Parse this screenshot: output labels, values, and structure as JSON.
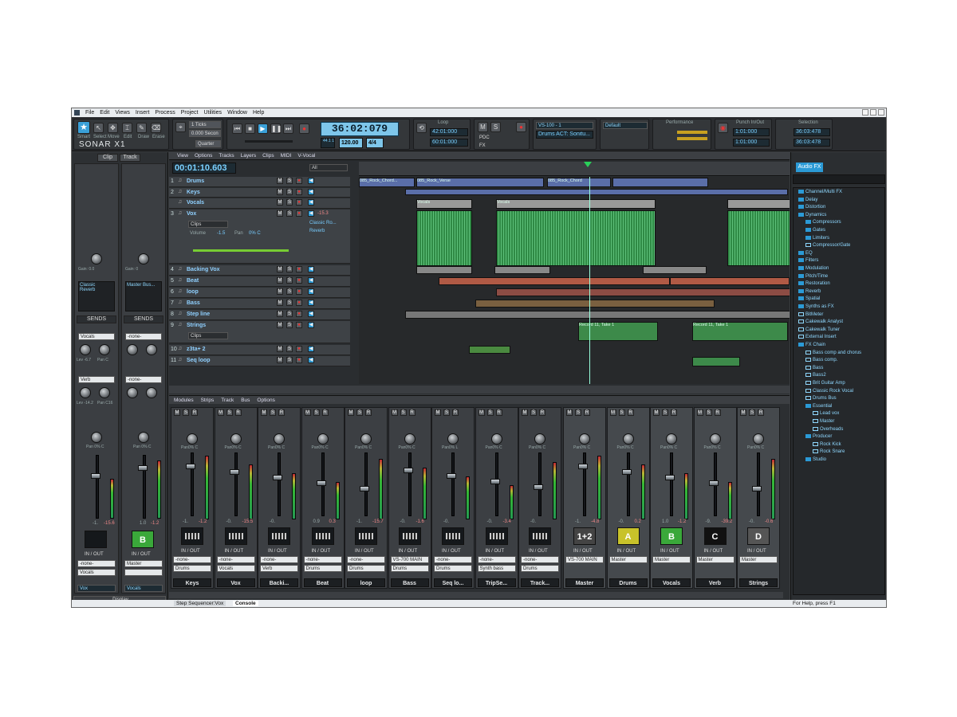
{
  "app": {
    "title": "SONAR X1"
  },
  "menu": [
    "File",
    "Edit",
    "Views",
    "Insert",
    "Process",
    "Project",
    "Utilities",
    "Window",
    "Help"
  ],
  "controlbar": {
    "tools": [
      "Smart",
      "Select",
      "Move",
      "Edit",
      "Draw",
      "Erase"
    ],
    "snap": {
      "value": "1 Ticks",
      "sub": "0.000 Secon",
      "quant": "Quarter"
    },
    "clock": "36:02:079",
    "tempo": "120.00",
    "meter": "4/4",
    "sig": "44.1 16",
    "loop": {
      "label": "Loop",
      "start": "42:01:000",
      "end": "60:01:000"
    },
    "vs": {
      "label": "VS-100 - 1",
      "preset": "Drums ACT: Sonitu..."
    },
    "default_label": "Default",
    "perf_label": "Performance",
    "punch": {
      "label": "Punch In/Out",
      "start": "1:01:000",
      "end": "1:01:000"
    },
    "selection": {
      "label": "Selection",
      "start": "36:03:478",
      "end": "36:03:478"
    },
    "pdc": "PDC",
    "fx": "FX"
  },
  "inspector": {
    "tabs": [
      "Clip",
      "Track"
    ],
    "strips": [
      {
        "gain": "Gain: 0.0",
        "pan": "Pan 0% C",
        "fx": [
          "Classic",
          "Reverb"
        ],
        "sends": "SENDS",
        "send1": "Vocals",
        "send2": "Verb",
        "lev1": "Lev -6.7",
        "pan1": "Pan C",
        "lev2": "Lev -14.2",
        "pan2": "Pan C16",
        "vol": "-1.",
        "peak": "-15.6",
        "letter": "",
        "io": "IN / OUT",
        "in": "-none-",
        "out": "Vocals",
        "name": "Vox"
      },
      {
        "gain": "Gain: 0",
        "pan": "Pan 0% C",
        "fx": [
          "Master Bus..."
        ],
        "sends": "SENDS",
        "send1": "-none-",
        "send2": "-none-",
        "lev1": "",
        "pan1": "",
        "lev2": "",
        "pan2": "",
        "vol": "1.0",
        "peak": "-1.2",
        "letter": "B",
        "io": "IN / OUT",
        "in": "Master",
        "out": "",
        "name": "Vocals"
      }
    ],
    "display": "Display"
  },
  "trackview": {
    "menu": [
      "View",
      "Options",
      "Tracks",
      "Layers",
      "Clips",
      "MIDI",
      "V-Vocal"
    ],
    "now": "00:01:10.603",
    "filter": "All",
    "tracks": [
      {
        "n": "1",
        "name": "Drums"
      },
      {
        "n": "2",
        "name": "Keys"
      },
      {
        "n": "",
        "name": "Vocals"
      },
      {
        "n": "3",
        "name": "Vox"
      },
      {
        "n": "4",
        "name": "Backing Vox"
      },
      {
        "n": "5",
        "name": "Beat"
      },
      {
        "n": "6",
        "name": "loop"
      },
      {
        "n": "7",
        "name": "Bass"
      },
      {
        "n": "8",
        "name": "Step line"
      },
      {
        "n": "9",
        "name": "Strings"
      },
      {
        "n": "10",
        "name": "z3ta+ 2"
      },
      {
        "n": "11",
        "name": "Seq loop"
      }
    ],
    "vox": {
      "clips": "Clips",
      "volume": "Volume",
      "vol_val": "-1.5",
      "pan": "Pan",
      "pan_val": "0% C",
      "fx1": "Classic Ro...",
      "fx2": "Reverb",
      "level": "-15.3"
    },
    "strings_clips": "Clips",
    "clip_labels": [
      "085_Rock_Chord...",
      "085_Rock_Verse",
      "085_Rock_Chord",
      "Vocals",
      "Vocals",
      "Record 11, Take 1",
      "Record 11, Take 1"
    ]
  },
  "console": {
    "menu": [
      "Modules",
      "Strips",
      "Track",
      "Bus",
      "Options"
    ],
    "strips": [
      {
        "pan": "Pan0% C",
        "vol": "-1.",
        "pk": "-1.2",
        "name": "Keys",
        "in": "-none-",
        "out": "Drums",
        "icon": "keyboard"
      },
      {
        "pan": "Pan0% C",
        "vol": "-0.",
        "pk": "-15.5",
        "name": "Vox",
        "in": "-none-",
        "out": "Vocals",
        "icon": "mic"
      },
      {
        "pan": "Pan0% C",
        "vol": "-0.",
        "pk": "",
        "name": "Backi...",
        "in": "-none-",
        "out": "Verb",
        "icon": "guitar"
      },
      {
        "pan": "Pan0% C",
        "vol": "0.9",
        "pk": "0.3",
        "name": "Beat",
        "in": "-none-",
        "out": "Drums",
        "icon": "rack"
      },
      {
        "pan": "Pan0% C",
        "vol": "-1.",
        "pk": "-15.7",
        "name": "loop",
        "in": "-none-",
        "out": "Drums",
        "icon": "wave"
      },
      {
        "pan": "Pan0% C",
        "vol": "-0.",
        "pk": "-1.6",
        "name": "Bass",
        "in": "VS-700 MAIN",
        "out": "Drums",
        "icon": "wave"
      },
      {
        "pan": "Pan0% L",
        "vol": "-0.",
        "pk": "",
        "name": "Seq lo...",
        "in": "-none-",
        "out": "Drums",
        "icon": "drums"
      },
      {
        "pan": "Pan0% C",
        "vol": "-0.",
        "pk": "-3.4",
        "name": "TripSe...",
        "in": "-none-",
        "out": "Synth bass",
        "icon": "keys"
      },
      {
        "pan": "Pan0% C",
        "vol": "-0.",
        "pk": "",
        "name": "Track...",
        "in": "-none-",
        "out": "Drums",
        "icon": "wave"
      }
    ],
    "buses": [
      {
        "pan": "Pan0% C",
        "vol": "-1.",
        "pk": "-4.8",
        "name": "Master",
        "letter": "1+2",
        "color": "#444",
        "out": "VS-700 MAIN"
      },
      {
        "pan": "Pan0% C",
        "vol": "-0.",
        "pk": "0.2",
        "name": "Drums",
        "letter": "A",
        "color": "#c8c22a",
        "out": "Master"
      },
      {
        "pan": "Pan0% C",
        "vol": "1.0",
        "pk": "-1.2",
        "name": "Vocals",
        "letter": "B",
        "color": "#3aa83a",
        "out": "Master"
      },
      {
        "pan": "Pan0% C",
        "vol": "-9.",
        "pk": "-39.2",
        "name": "Verb",
        "letter": "C",
        "color": "#111",
        "out": "Master"
      },
      {
        "pan": "Pan0% C",
        "vol": "-0.",
        "pk": "-0.6",
        "name": "Strings",
        "letter": "D",
        "color": "#555",
        "out": "Master"
      }
    ],
    "io": "IN / OUT"
  },
  "browser": {
    "tab": "Audio FX",
    "items": [
      {
        "t": "Channel/Multi FX",
        "lvl": 0,
        "f": 1
      },
      {
        "t": "Delay",
        "lvl": 0,
        "f": 1
      },
      {
        "t": "Distortion",
        "lvl": 0,
        "f": 1
      },
      {
        "t": "Dynamics",
        "lvl": 0,
        "f": 1
      },
      {
        "t": "Compressors",
        "lvl": 1,
        "f": 1
      },
      {
        "t": "Gates",
        "lvl": 1,
        "f": 1
      },
      {
        "t": "Limiters",
        "lvl": 1,
        "f": 1
      },
      {
        "t": "Compressor/Gate",
        "lvl": 1,
        "f": 0
      },
      {
        "t": "EQ",
        "lvl": 0,
        "f": 1
      },
      {
        "t": "Filters",
        "lvl": 0,
        "f": 1
      },
      {
        "t": "Modulation",
        "lvl": 0,
        "f": 1
      },
      {
        "t": "Pitch/Time",
        "lvl": 0,
        "f": 1
      },
      {
        "t": "Restoration",
        "lvl": 0,
        "f": 1
      },
      {
        "t": "Reverb",
        "lvl": 0,
        "f": 1
      },
      {
        "t": "Spatial",
        "lvl": 0,
        "f": 1
      },
      {
        "t": "Synths as FX",
        "lvl": 0,
        "f": 1
      },
      {
        "t": "BitMeter",
        "lvl": 0,
        "f": 0
      },
      {
        "t": "Cakewalk Analyst",
        "lvl": 0,
        "f": 0
      },
      {
        "t": "Cakewalk Tuner",
        "lvl": 0,
        "f": 0
      },
      {
        "t": "External Insert",
        "lvl": 0,
        "f": 0
      },
      {
        "t": "FX Chain",
        "lvl": 0,
        "f": 1
      },
      {
        "t": "Bass comp and chorus",
        "lvl": 1,
        "f": 0
      },
      {
        "t": "Bass comp.",
        "lvl": 1,
        "f": 0
      },
      {
        "t": "Bass",
        "lvl": 1,
        "f": 0
      },
      {
        "t": "Bass2",
        "lvl": 1,
        "f": 0
      },
      {
        "t": "Brit Guitar Amp",
        "lvl": 1,
        "f": 0
      },
      {
        "t": "Classic Rock Vocal",
        "lvl": 1,
        "f": 0
      },
      {
        "t": "Drums Bus",
        "lvl": 1,
        "f": 0
      },
      {
        "t": "Essential",
        "lvl": 1,
        "f": 1
      },
      {
        "t": "Lead vox",
        "lvl": 2,
        "f": 0
      },
      {
        "t": "Master",
        "lvl": 2,
        "f": 0
      },
      {
        "t": "Overheads",
        "lvl": 2,
        "f": 0
      },
      {
        "t": "Producer",
        "lvl": 1,
        "f": 1
      },
      {
        "t": "Rock Kick",
        "lvl": 2,
        "f": 0
      },
      {
        "t": "Rock Snare",
        "lvl": 2,
        "f": 0
      },
      {
        "t": "Studio",
        "lvl": 1,
        "f": 1
      }
    ]
  },
  "status": {
    "tabs": [
      "Step Sequencer:Vox",
      "Console"
    ],
    "help": "For Help, press F1"
  }
}
